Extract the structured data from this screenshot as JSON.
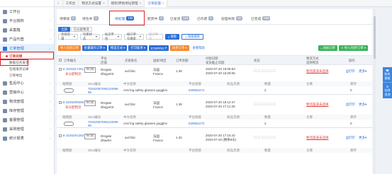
{
  "sidebar": {
    "items": [
      {
        "label": "工作台"
      },
      {
        "label": "平台授权"
      },
      {
        "label": "采集箱"
      },
      {
        "label": "产品刊登"
      },
      {
        "label": "订单管理"
      },
      {
        "label": "售后中心"
      },
      {
        "label": "营销中心"
      },
      {
        "label": "物流管理"
      },
      {
        "label": "库存管理"
      },
      {
        "label": "客服管理"
      },
      {
        "label": "采购管理"
      },
      {
        "label": "统计报表"
      }
    ],
    "sub": [
      {
        "label": "订单处理"
      },
      {
        "label": "数据任务发货"
      },
      {
        "label": "在线发货记录"
      },
      {
        "label": "订单导出"
      }
    ]
  },
  "topbar": {
    "tabs": [
      "工作台",
      "物流方式设置",
      "授权/原始地址管理",
      "订单处理"
    ]
  },
  "status_tabs": [
    {
      "label": "待审核",
      "count": "0"
    },
    {
      "label": "待合并",
      "count": "0"
    },
    {
      "label": "待处理",
      "count": "155"
    },
    {
      "label": "配货中",
      "count": "0"
    },
    {
      "label": "已发货",
      "count": "118"
    },
    {
      "label": "已作废",
      "count": "0"
    },
    {
      "label": "处理失败",
      "count": "50"
    },
    {
      "label": "已完成",
      "count": "598"
    }
  ],
  "filters": {
    "row1": [
      "全部",
      "已分配物流"
    ],
    "selects": [
      "全部店铺",
      "包裹状态",
      "标记平台",
      "按订单号搜索",
      "按订单号"
    ],
    "search": "搜索",
    "advanced": "高级搜索"
  },
  "actions": {
    "left": [
      "导入包括订单",
      "批量操作订单",
      "物流方式",
      "打印面单",
      "ETSPPIG",
      "同步订单",
      "查看帮助"
    ],
    "right": [
      "添加订单",
      "导入/同步订单"
    ]
  },
  "table_headers": {
    "order_no": "订单编号",
    "platform": "平台\n店铺",
    "buyer": "买家姓名",
    "country": "国家/地区",
    "amount": "订单金额",
    "time": "付款日期\n发货截止日期",
    "status": "状态",
    "logistics": "物流方式\n选择物流",
    "ops": "操作"
  },
  "sub_headers": {
    "thumb": "缩略图",
    "sku": "SKU编号",
    "cn_name": "中文名称",
    "platform_link": "平台链接",
    "product_no": "商品货源",
    "qty": "数量",
    "warehouse": "仓库",
    "stock": "库存"
  },
  "orders": [
    {
      "order_no": "3225317461",
      "tag": "待付款",
      "tag2": "未分配物流",
      "platform": "DHgate",
      "store": "dhajye03",
      "buyer": "axil bbc",
      "country": "法国",
      "country_en": "France",
      "amount": "1.38",
      "pay_date": "2020-07-20 19:08:53",
      "deadline": "2020-07-20 16:09:05",
      "logistics": "物流渠道未选择",
      "op1": "打印",
      "op2": "更多",
      "sku": "70262087595120098",
      "sku2": "96",
      "cn_name": "Anti fog safety glasses goggles",
      "link": "529682272",
      "qty": "2",
      "warehouse": "",
      "stock": "0"
    },
    {
      "order_no": "3225295058",
      "tag": "待付款",
      "tag2": "未分配物流",
      "platform": "DHgate",
      "store": "dhajye03",
      "buyer": "axil bbc",
      "country": "法国",
      "country_en": "France",
      "amount": "1.38",
      "pay_date": "2020-07-20 18:12:47",
      "deadline": "2020-07-20 17:11:26",
      "logistics": "物流渠道未选择",
      "op1": "打印",
      "op2": "更多",
      "sku": "70262087595120098",
      "sku2": "96",
      "cn_name": "Anti fog safety glasses goggles",
      "link": "529682272",
      "qty": "2",
      "warehouse": "",
      "stock": "0"
    },
    {
      "order_no": "3225291283",
      "tag": "待付款",
      "tag2": "",
      "platform": "DHgate",
      "store": "dhaefer",
      "buyer": "axil bbc",
      "country": "法国",
      "country_en": "France",
      "amount": "1.32",
      "pay_date": "2020-07-20 17:15:42",
      "deadline": "2020-07-20 (剩余8天)",
      "logistics": "物流渠道未选择",
      "op1": "打印",
      "op2": "更多",
      "sku": "",
      "sku2": "",
      "cn_name": "",
      "link": "",
      "qty": "",
      "warehouse": "",
      "stock": ""
    }
  ],
  "float": [
    "联系\n客服",
    "在线\n咨询"
  ]
}
